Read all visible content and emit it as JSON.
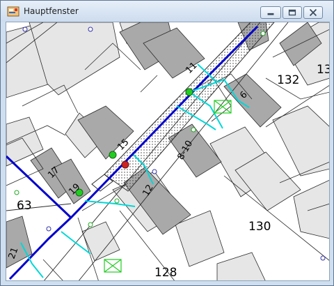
{
  "window": {
    "title": "Hauptfenster",
    "controls": {
      "minimize": "minimize",
      "maximize": "maximize",
      "close": "close"
    }
  },
  "map": {
    "parcel_labels": {
      "p63": "63",
      "p130": "130",
      "p128": "128",
      "p132": "132",
      "p13": "13"
    },
    "house_numbers": {
      "h11": "11",
      "h6": "6",
      "h15": "15",
      "h810": "8-10",
      "h17": "17",
      "h19": "19",
      "h12": "12",
      "h21": "21"
    },
    "colors": {
      "building": "#a9a9a9",
      "parcel_outline": "#2b2b2b",
      "main_pipe": "#0000cc",
      "service_line": "#00d8d8",
      "node_green": "#22cc22",
      "node_red": "#cc2222",
      "strip_fill": "#ffffff"
    }
  }
}
